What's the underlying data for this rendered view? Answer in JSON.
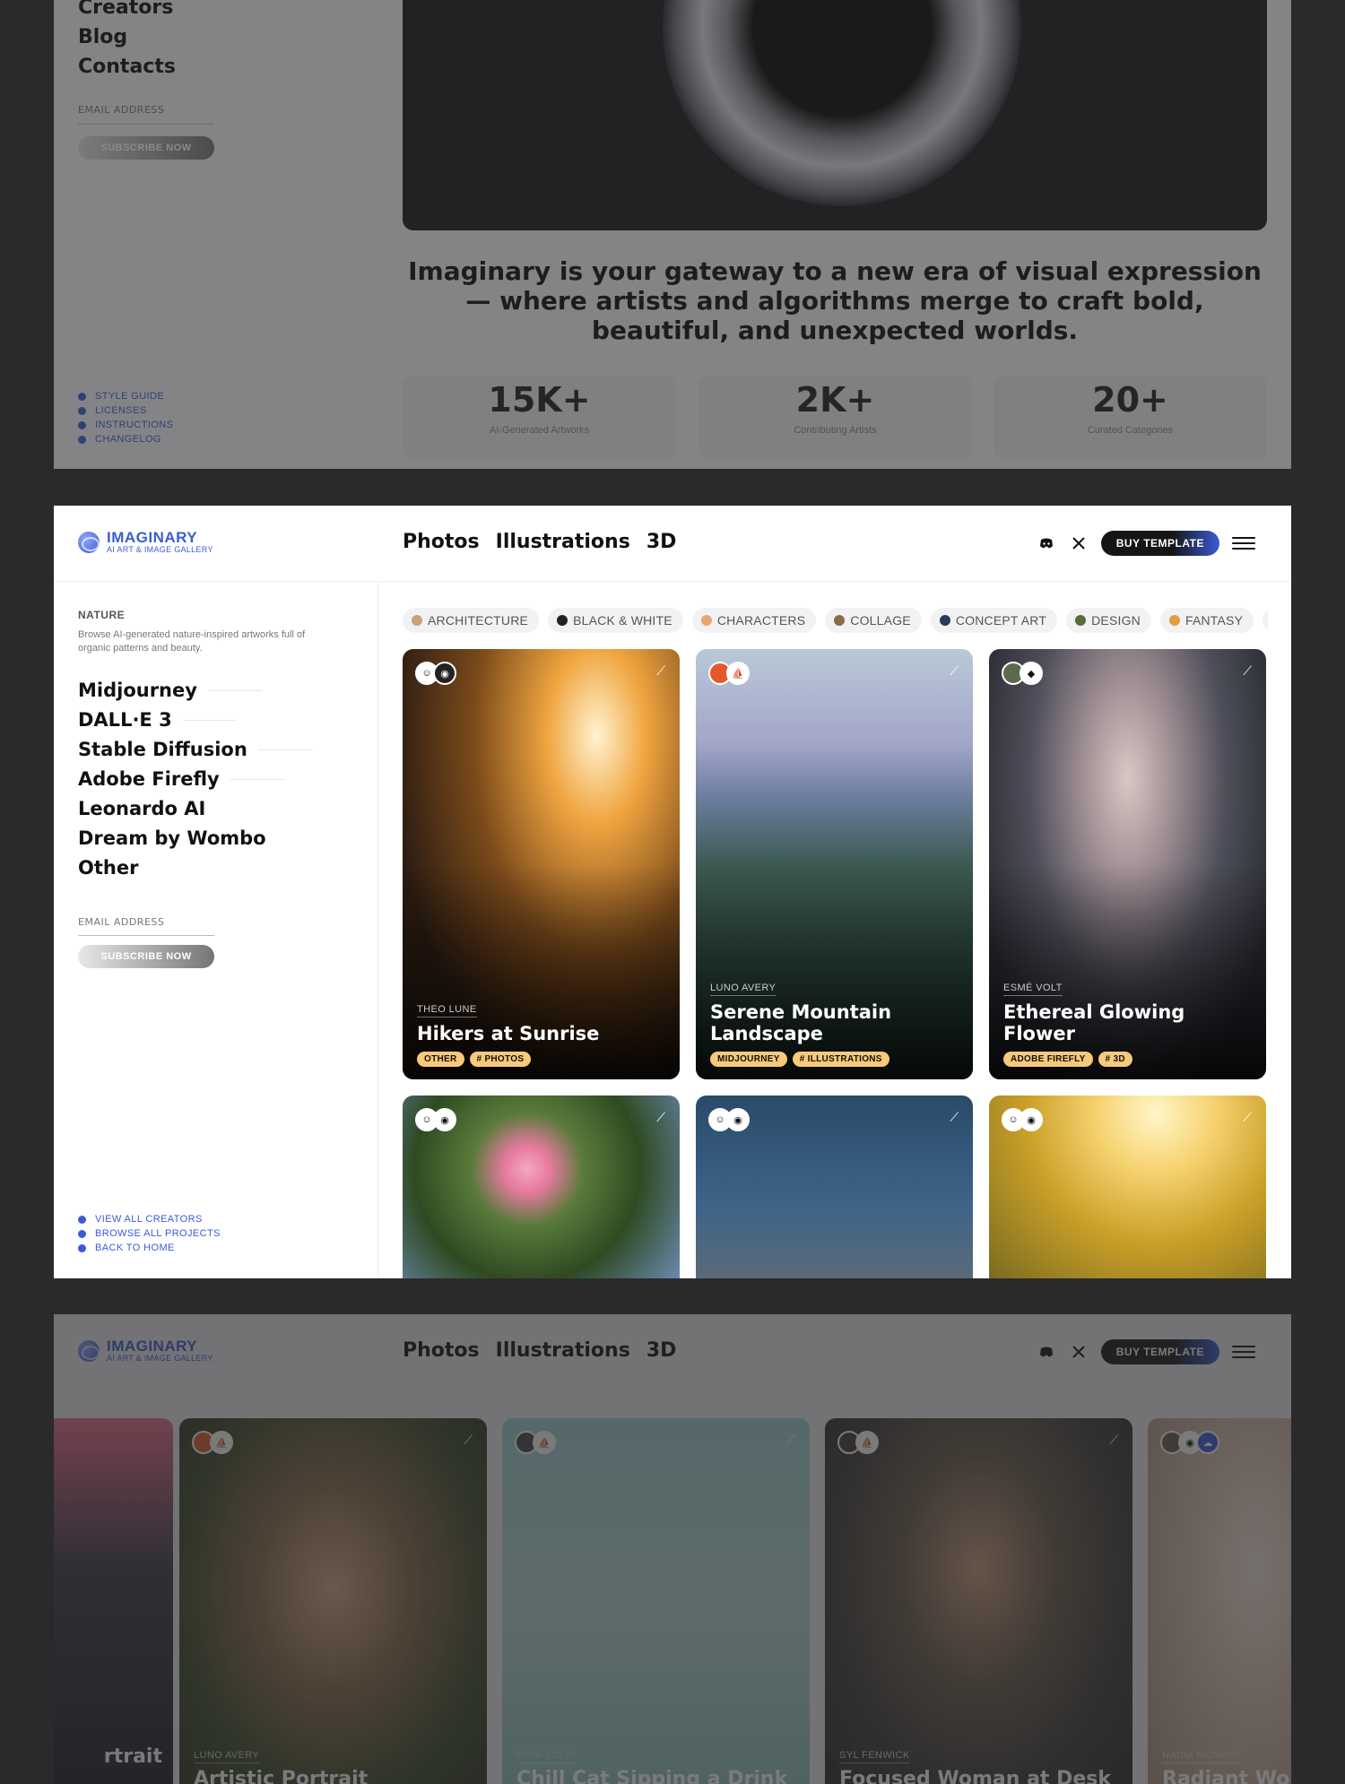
{
  "top_frame": {
    "side_links": [
      "Creators",
      "Blog",
      "Contacts"
    ],
    "email_label": "EMAIL ADDRESS",
    "subscribe_label": "SUBSCRIBE NOW",
    "footer_links": [
      "STYLE GUIDE",
      "LICENSES",
      "INSTRUCTIONS",
      "CHANGELOG"
    ],
    "tagline": "Imaginary is your gateway to a new era of visual expression — where artists and algorithms merge to craft bold, beautiful, and unexpected worlds.",
    "stats": [
      {
        "value": "15K+",
        "label": "AI-Generated Artworks"
      },
      {
        "value": "2K+",
        "label": "Contributing Artists"
      },
      {
        "value": "20+",
        "label": "Curated Categories"
      }
    ]
  },
  "header": {
    "logo_name": "IMAGINARY",
    "logo_sub": "AI ART & IMAGE GALLERY",
    "nav": [
      "Photos",
      "Illustrations",
      "3D"
    ],
    "buy_label": "BUY TEMPLATE"
  },
  "sidebar": {
    "category": "NATURE",
    "description": "Browse AI-generated nature-inspired artworks full of organic patterns and beauty.",
    "models": [
      "Midjourney",
      "DALL·E 3",
      "Stable Diffusion",
      "Adobe Firefly",
      "Leonardo AI",
      "Dream by Wombo",
      "Other"
    ],
    "email_label": "EMAIL ADDRESS",
    "subscribe_label": "SUBSCRIBE NOW",
    "footer_links": [
      "VIEW ALL CREATORS",
      "BROWSE ALL PROJECTS",
      "BACK TO HOME"
    ]
  },
  "chips": [
    {
      "label": "ARCHITECTURE",
      "color": "#c9a27a"
    },
    {
      "label": "BLACK & WHITE",
      "color": "#222222"
    },
    {
      "label": "CHARACTERS",
      "color": "#e8a66a"
    },
    {
      "label": "COLLAGE",
      "color": "#8a6a4a"
    },
    {
      "label": "CONCEPT ART",
      "color": "#2b3a5a"
    },
    {
      "label": "DESIGN",
      "color": "#5a6a3a"
    },
    {
      "label": "FANTASY",
      "color": "#e0a040"
    }
  ],
  "cards": [
    {
      "author": "THEO LUNE",
      "title": "Hikers at Sunrise",
      "tags": [
        "OTHER",
        "# PHOTOS"
      ]
    },
    {
      "author": "LUNO AVERY",
      "title": "Serene Mountain Landscape",
      "tags": [
        "MIDJOURNEY",
        "# ILLUSTRATIONS"
      ]
    },
    {
      "author": "ESMÉ VOLT",
      "title": "Ethereal Glowing Flower",
      "tags": [
        "ADOBE FIREFLY",
        "# 3D"
      ]
    }
  ],
  "bottom_cards": [
    {
      "author": "",
      "title": "rtrait"
    },
    {
      "author": "LUNO AVERY",
      "title": "Artistic Portrait Outdoors"
    },
    {
      "author": "MIRA TOLIN",
      "title": "Chill Cat Sipping a Drink"
    },
    {
      "author": "SYL FENWICK",
      "title": "Focused Woman at Desk"
    },
    {
      "author": "NADIA MONROE",
      "title": "Radiant Wom"
    }
  ]
}
